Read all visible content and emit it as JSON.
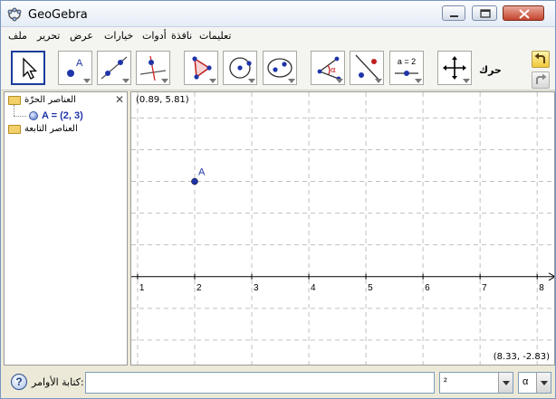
{
  "window": {
    "title": "GeoGebra"
  },
  "menu": {
    "items": [
      {
        "id": "file",
        "label": "ملف"
      },
      {
        "id": "edit",
        "label": "تحرير"
      },
      {
        "id": "view",
        "label": "عرض"
      },
      {
        "id": "options",
        "label": "خيارات"
      },
      {
        "id": "tools",
        "label": "أدوات"
      },
      {
        "id": "window",
        "label": "نافذة"
      },
      {
        "id": "help",
        "label": "تعليمات"
      }
    ]
  },
  "toolbar": {
    "tools": [
      {
        "id": "move",
        "icon": "arrow-pointer-icon",
        "active": true
      },
      {
        "id": "new-point",
        "icon": "point-icon"
      },
      {
        "id": "line",
        "icon": "line-through-two-points-icon"
      },
      {
        "id": "perpendicular",
        "icon": "perpendicular-line-icon"
      },
      {
        "id": "polygon",
        "icon": "polygon-icon"
      },
      {
        "id": "circle-center",
        "icon": "circle-with-center-icon"
      },
      {
        "id": "conic",
        "icon": "conic-through-points-icon"
      },
      {
        "id": "angle",
        "icon": "angle-icon"
      },
      {
        "id": "reflect",
        "icon": "reflect-about-line-icon"
      },
      {
        "id": "slider",
        "icon": "slider-icon",
        "text": "a = 2"
      },
      {
        "id": "move-graphics",
        "icon": "move-graphics-view-icon"
      }
    ],
    "tool_help": "حرك",
    "undo_icon": "undo-icon",
    "redo_icon": "redo-icon"
  },
  "algebra": {
    "free_objects_label": "العناصر الحرّة",
    "dependent_objects_label": "العناصر التابعة",
    "free_objects": [
      {
        "name": "A",
        "label": "A = (2, 3)",
        "x": 2,
        "y": 3,
        "color": "#1f34a8"
      }
    ]
  },
  "graphics": {
    "corner_top_left": "(0.89, 5.81)",
    "corner_bottom_right": "(8.33, -2.83)",
    "x_min": 0.89,
    "x_max": 8.33,
    "y_min": -2.83,
    "y_max": 5.81,
    "x_ticks": [
      1,
      2,
      3,
      4,
      5,
      6,
      7,
      8
    ],
    "grid": true,
    "points": [
      {
        "name": "A",
        "x": 2,
        "y": 3,
        "color": "#1f34a8"
      }
    ]
  },
  "input_bar": {
    "label": "كتابة الأوامر:",
    "value": "",
    "symbol_value": "²",
    "greek_value": "α"
  }
}
